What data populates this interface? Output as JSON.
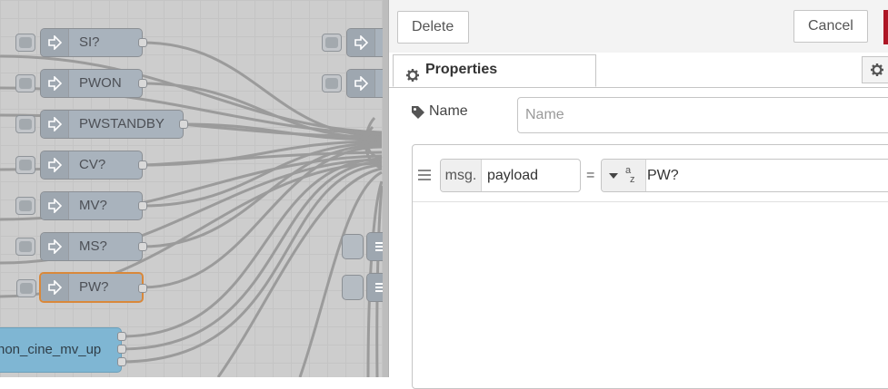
{
  "flow": {
    "nodes": [
      {
        "label": "SI?"
      },
      {
        "label": "PWON"
      },
      {
        "label": "PWSTANDBY"
      },
      {
        "label": "CV?"
      },
      {
        "label": "MV?"
      },
      {
        "label": "MS?"
      },
      {
        "label": "PW?",
        "selected": true
      }
    ],
    "mqtt_node_label": "non_cine_mv_up"
  },
  "toolbar": {
    "delete_label": "Delete",
    "cancel_label": "Cancel"
  },
  "tabs": {
    "properties_label": "Properties"
  },
  "form": {
    "name_label": "Name",
    "name_placeholder": "Name",
    "name_value": "",
    "rule": {
      "property_prefix": "msg.",
      "property_value": "payload",
      "operator": "=",
      "value_type_icon": "az",
      "value": "PW?"
    }
  },
  "colors": {
    "workspace_bg": "#cdcdcd",
    "node_fill": "#a9b3bd",
    "selected_outline": "#d9883a",
    "mqtt_node_fill": "#7fb6d3",
    "done_button": "#ad1625"
  }
}
